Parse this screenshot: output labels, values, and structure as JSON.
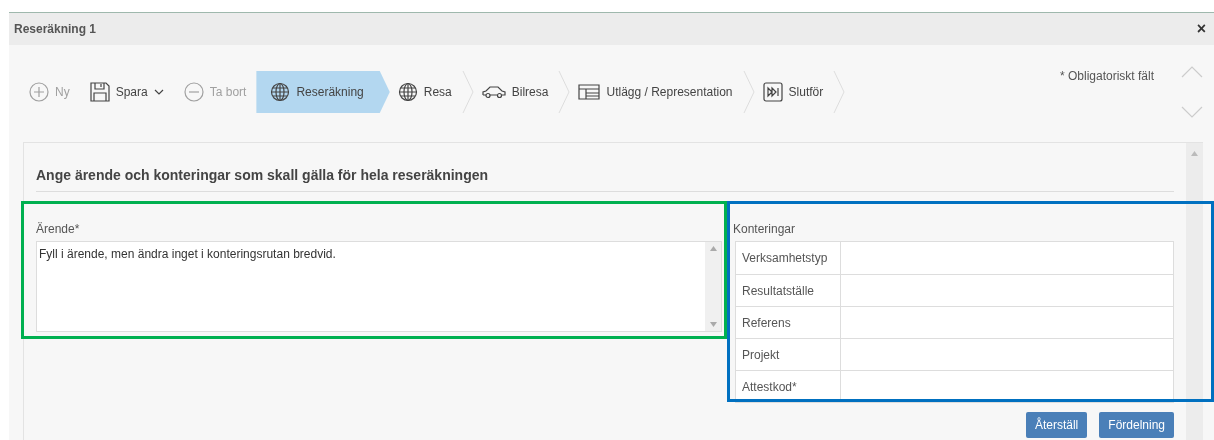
{
  "window": {
    "title": "Reseräkning 1",
    "close": "×"
  },
  "toolbar": [
    {
      "kind": "action",
      "label": "Ny",
      "disabled": true,
      "dropdown": false
    },
    {
      "kind": "action",
      "label": "Spara",
      "disabled": false,
      "dropdown": true
    },
    {
      "kind": "action",
      "label": "Ta bort",
      "disabled": true,
      "dropdown": false
    },
    {
      "kind": "step",
      "label": "Reseräkning",
      "selected": true
    },
    {
      "kind": "step",
      "label": "Resa",
      "selected": false
    },
    {
      "kind": "step",
      "label": "Bilresa",
      "selected": false
    },
    {
      "kind": "step",
      "label": "Utlägg / Representation",
      "selected": false
    },
    {
      "kind": "step",
      "label": "Slutför",
      "selected": false
    }
  ],
  "required_note": "* Obligatoriskt fält",
  "section_title": "Ange ärende och konteringar som skall gälla för hela reseräkningen",
  "arende": {
    "label": "Ärende*",
    "value": "Fyll i ärende, men ändra inget i konteringsrutan bredvid."
  },
  "konteringar": {
    "label": "Konteringar",
    "rows": [
      {
        "label": "Verksamhetstyp"
      },
      {
        "label": "Resultatställe"
      },
      {
        "label": "Referens"
      },
      {
        "label": "Projekt"
      },
      {
        "label": "Attestkod*"
      }
    ]
  },
  "buttons": [
    "Återställ",
    "Fördelning"
  ],
  "highlights": [
    {
      "color": "#00b050"
    },
    {
      "color": "#0070c0"
    }
  ]
}
